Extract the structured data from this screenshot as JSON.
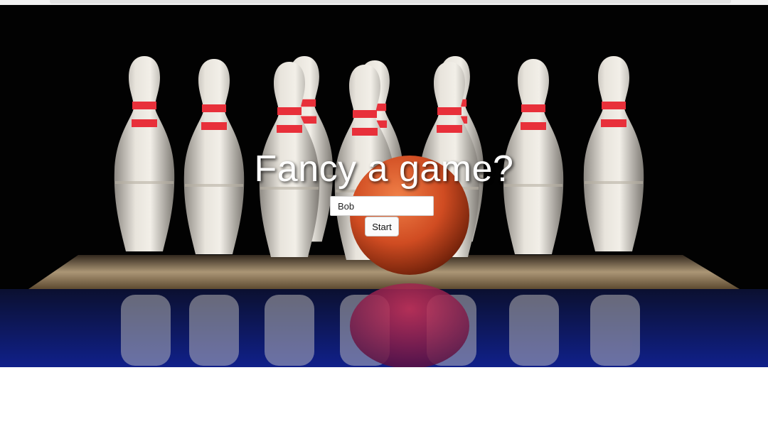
{
  "hero": {
    "headline": "Fancy a game?",
    "background_image": "bowling-pins-and-ball-photo"
  },
  "form": {
    "name_value": "Bob",
    "start_label": "Start"
  },
  "colors": {
    "pin_stripe": "#e8303a",
    "ball": "#d8502a",
    "background": "#000000"
  }
}
